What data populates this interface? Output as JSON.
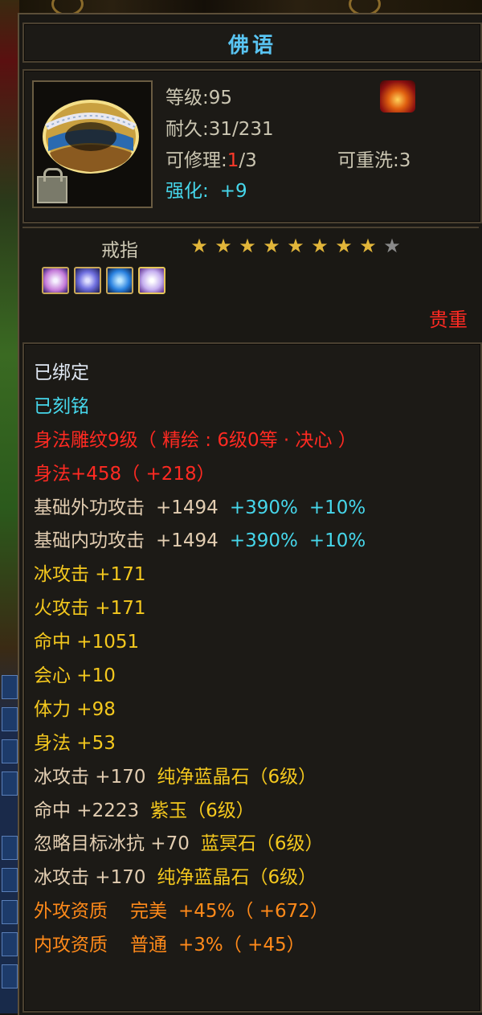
{
  "item": {
    "name": "佛语",
    "level": "等级:95",
    "durability": "耐久:31/231",
    "repair_prefix": "可修理:",
    "repair_current": "1",
    "repair_suffix": "/3",
    "rewash": "可重洗:3",
    "enhance_label": "强化:",
    "enhance_value": "+9",
    "type": "戒指",
    "stars_filled": 8,
    "stars_total": 9,
    "rarity": "贵重"
  },
  "colors": {
    "title": "#59c4f2",
    "cyan": "#46d6ea",
    "red": "#ff2a22",
    "yellow": "#f4c81e",
    "orange": "#ff8a1a",
    "star": "#e2b63a"
  },
  "icons": [
    "ring-item-icon",
    "lock-icon",
    "fire-badge-icon",
    "gem-icon"
  ],
  "attributes": {
    "bound": "已绑定",
    "engraved": "已刻铭",
    "carving": "身法雕纹9级（ 精绘 : 6级0等 · 决心 ）",
    "agility_bonus": "身法+458（ +218）",
    "ext_attack_label": "基础外功攻击",
    "ext_attack_value": "+1494",
    "ext_attack_pct1": "+390%",
    "ext_attack_pct2": "+10%",
    "int_attack_label": "基础内功攻击",
    "int_attack_value": "+1494",
    "int_attack_pct1": "+390%",
    "int_attack_pct2": "+10%",
    "lines_yellow": [
      "冰攻击 +171",
      "火攻击 +171",
      "命中 +1051",
      "会心 +10",
      "体力 +98",
      "身法 +53"
    ],
    "gem1_stat": "冰攻击 +170",
    "gem1_name": "纯净蓝晶石（6级）",
    "gem2_stat": "命中 +2223",
    "gem2_name": "紫玉（6级）",
    "gem3_stat": "忽略目标冰抗 +70",
    "gem3_name": "蓝冥石（6级）",
    "gem4_stat": "冰攻击 +170",
    "gem4_name": "纯净蓝晶石（6级）",
    "ext_quality_label": "外攻资质",
    "ext_quality_grade": "完美",
    "ext_quality_value": "+45%（ +672）",
    "int_quality_label": "内攻资质",
    "int_quality_grade": "普通",
    "int_quality_value": "+3%（ +45）"
  }
}
